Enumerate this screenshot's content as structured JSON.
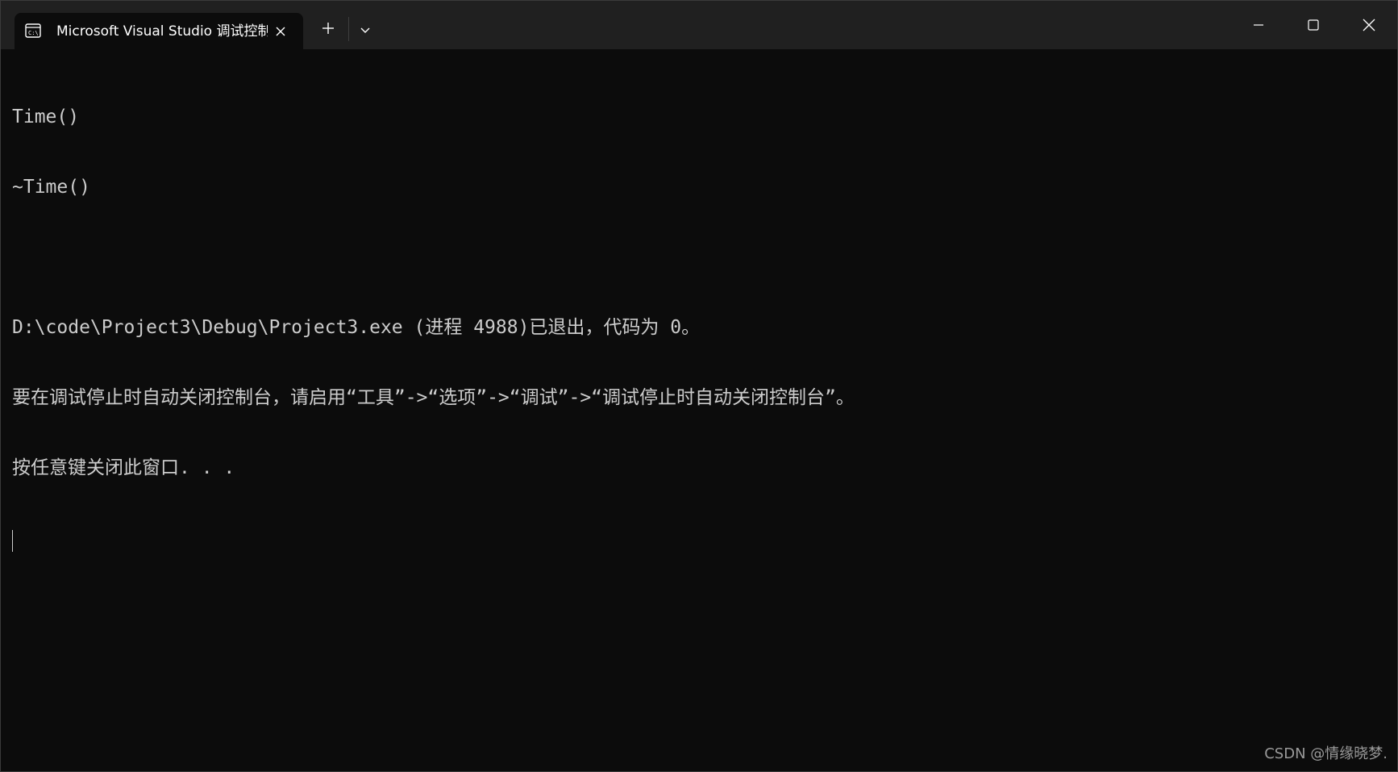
{
  "window": {
    "tab_title": "Microsoft Visual Studio 调试控制台",
    "tab_icon": "console-icon",
    "colors": {
      "titlebar": "#202020",
      "console_bg": "#0c0c0c",
      "console_text": "#cccccc"
    }
  },
  "console": {
    "lines": [
      "Time()",
      "~Time()",
      "",
      "D:\\code\\Project3\\Debug\\Project3.exe (进程 4988)已退出，代码为 0。",
      "要在调试停止时自动关闭控制台，请启用“工具”->“选项”->“调试”->“调试停止时自动关闭控制台”。",
      "按任意键关闭此窗口. . ."
    ]
  },
  "watermark": "CSDN @情缘晓梦."
}
